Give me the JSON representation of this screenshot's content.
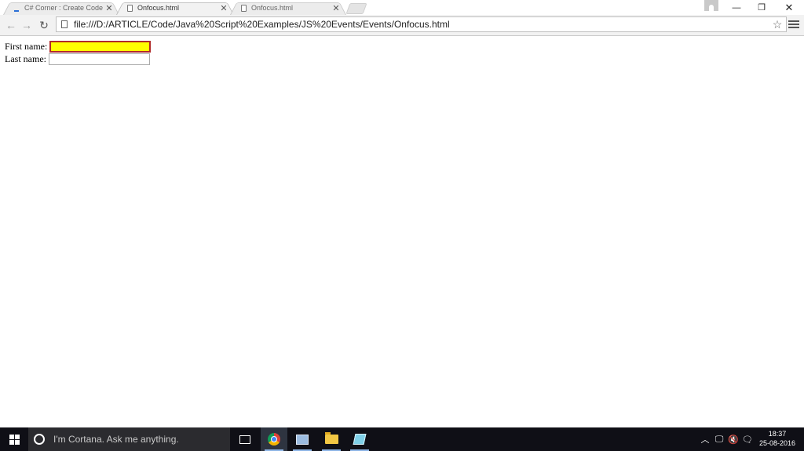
{
  "tabs": [
    {
      "title": "C# Corner : Create Code S",
      "favicon": "csharpcorner-icon",
      "active": false
    },
    {
      "title": "Onfocus.html",
      "favicon": "page-icon",
      "active": true
    },
    {
      "title": "Onfocus.html",
      "favicon": "page-icon",
      "active": false
    }
  ],
  "toolbar": {
    "url": "file:///D:/ARTICLE/Code/Java%20Script%20Examples/JS%20Events/Events/Onfocus.html"
  },
  "page": {
    "first_name_label": "First name:",
    "first_name_value": "",
    "last_name_label": "Last name:",
    "last_name_value": ""
  },
  "taskbar": {
    "search_placeholder": "I'm Cortana. Ask me anything.",
    "time": "18:37",
    "date": "25-08-2016"
  },
  "colors": {
    "focus_background": "#ffff00",
    "focus_border": "#b02a2a",
    "taskbar": "#0f0f16"
  }
}
